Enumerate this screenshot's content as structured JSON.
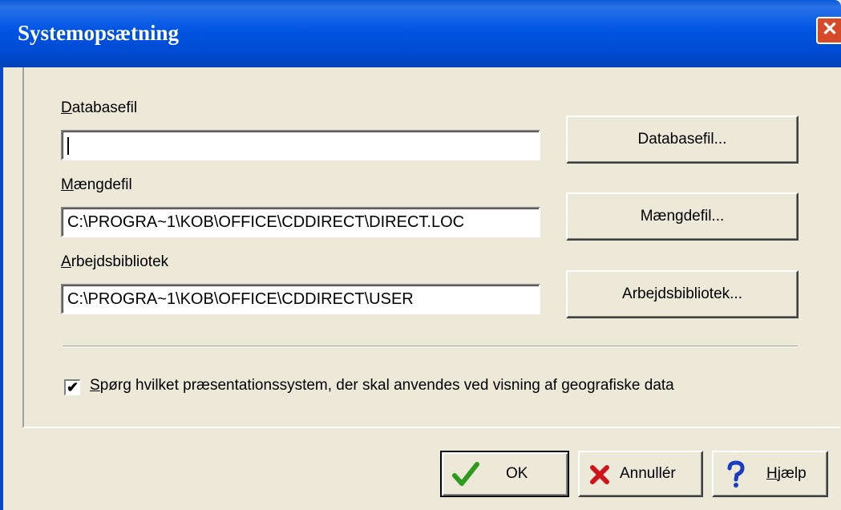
{
  "window": {
    "title": "Systemopsætning",
    "close_glyph": "✕"
  },
  "database": {
    "label": "Databasefil",
    "value": "",
    "button": "Databasefil..."
  },
  "quantity": {
    "label": "Mængdefil",
    "value": "C:\\PROGRA~1\\KOB\\OFFICE\\CDDIRECT\\DIRECT.LOC",
    "button": "Mængdefil..."
  },
  "workdir": {
    "label": "Arbejdsbibliotek",
    "value": "C:\\PROGRA~1\\KOB\\OFFICE\\CDDIRECT\\USER",
    "button": "Arbejdsbibliotek..."
  },
  "option": {
    "checked": true,
    "check_glyph": "✔",
    "label": "Spørg hvilket præsentationssystem, der skal anvendes ved visning af geografiske data"
  },
  "buttons": {
    "ok": "OK",
    "cancel": "Annullér",
    "help": "Hjælp"
  },
  "icons": {
    "ok": "checkmark-icon",
    "cancel": "x-icon",
    "help": "question-icon"
  },
  "colors": {
    "titlebar": "#0054e3",
    "ok_check": "#2e9a1e",
    "cancel_x": "#d0141c",
    "help_q": "#1a3cc0"
  }
}
